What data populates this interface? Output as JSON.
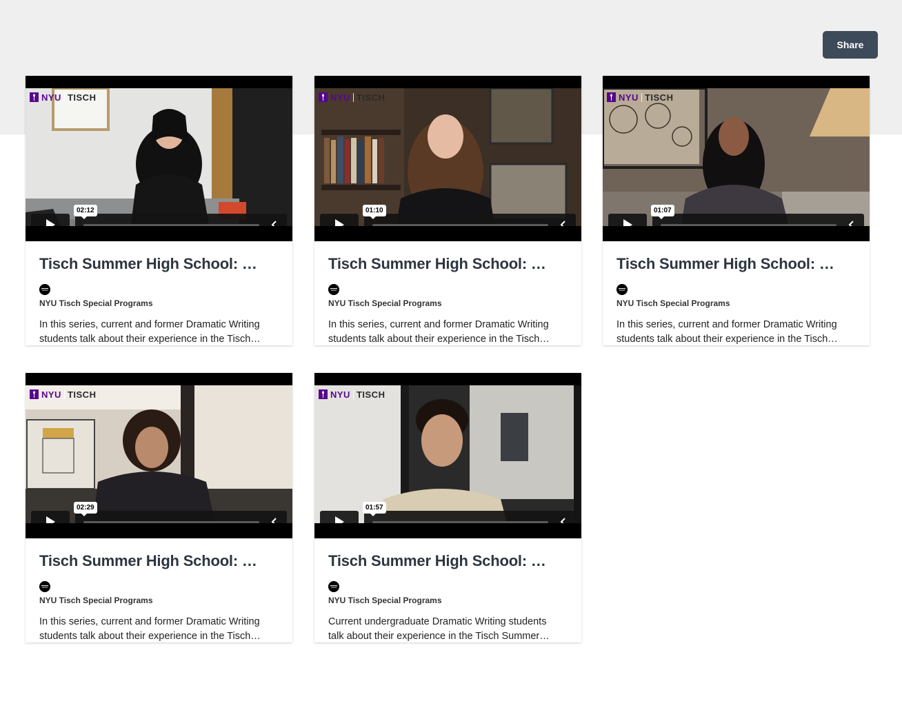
{
  "header": {
    "share_label": "Share"
  },
  "logo": {
    "brand_left": "NYU",
    "brand_right": "TISCH"
  },
  "videos": [
    {
      "title": "Tisch Summer High School: …",
      "duration": "02:12",
      "channel": "NYU Tisch Special Programs",
      "description_line1": "In this series, current and former Dramatic Writing",
      "description_line2": "students talk about their experience in the Tisch…"
    },
    {
      "title": "Tisch Summer High School: …",
      "duration": "01:10",
      "channel": "NYU Tisch Special Programs",
      "description_line1": "In this series, current and former Dramatic Writing",
      "description_line2": "students talk about their experience in the Tisch…"
    },
    {
      "title": "Tisch Summer High School: …",
      "duration": "01:07",
      "channel": "NYU Tisch Special Programs",
      "description_line1": "In this series, current and former Dramatic Writing",
      "description_line2": "students talk about their experience in the Tisch…"
    },
    {
      "title": "Tisch Summer High School: …",
      "duration": "02:29",
      "channel": "NYU Tisch Special Programs",
      "description_line1": "In this series, current and former Dramatic Writing",
      "description_line2": "students talk about their experience in the Tisch…"
    },
    {
      "title": "Tisch Summer High School: …",
      "duration": "01:57",
      "channel": "NYU Tisch Special Programs",
      "description_line1": "Current undergraduate Dramatic Writing students",
      "description_line2": "talk about their experience in the Tisch Summer…"
    }
  ],
  "colors": {
    "brand_purple": "#57068c",
    "share_button": "#3d4a59",
    "top_band": "#efefef"
  }
}
